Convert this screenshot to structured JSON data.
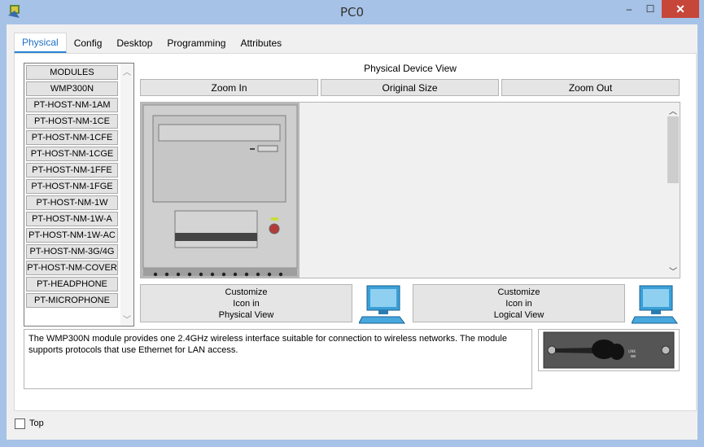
{
  "window": {
    "title": "PC0",
    "minimize_glyph": "–",
    "maximize_glyph": "☐",
    "close_glyph": "✕"
  },
  "tabs": [
    {
      "label": "Physical",
      "active": true
    },
    {
      "label": "Config"
    },
    {
      "label": "Desktop"
    },
    {
      "label": "Programming"
    },
    {
      "label": "Attributes"
    }
  ],
  "modules": [
    "MODULES",
    "WMP300N",
    "PT-HOST-NM-1AM",
    "PT-HOST-NM-1CE",
    "PT-HOST-NM-1CFE",
    "PT-HOST-NM-1CGE",
    "PT-HOST-NM-1FFE",
    "PT-HOST-NM-1FGE",
    "PT-HOST-NM-1W",
    "PT-HOST-NM-1W-A",
    "PT-HOST-NM-1W-AC",
    "PT-HOST-NM-3G/4G",
    "PT-HOST-NM-COVER",
    "PT-HEADPHONE",
    "PT-MICROPHONE"
  ],
  "physical_view": {
    "title": "Physical Device View",
    "zoom_in": "Zoom In",
    "original_size": "Original Size",
    "zoom_out": "Zoom Out"
  },
  "customize": {
    "physical": {
      "line1": "Customize",
      "line2": "Icon in",
      "line3": "Physical View"
    },
    "logical": {
      "line1": "Customize",
      "line2": "Icon in",
      "line3": "Logical View"
    }
  },
  "description": "The WMP300N module provides one 2.4GHz wireless interface suitable for connection to wireless networks. The module supports protocols that use Ethernet for LAN access.",
  "module_image_label": "LINK",
  "footer": {
    "top_label": "Top",
    "top_checked": false
  },
  "icons": {
    "app": "packet-tracer-icon",
    "computer": "computer-monitor-icon"
  },
  "colors": {
    "accent": "#2a85d6",
    "close": "#c7463a",
    "frame": "#a6c2e6"
  }
}
